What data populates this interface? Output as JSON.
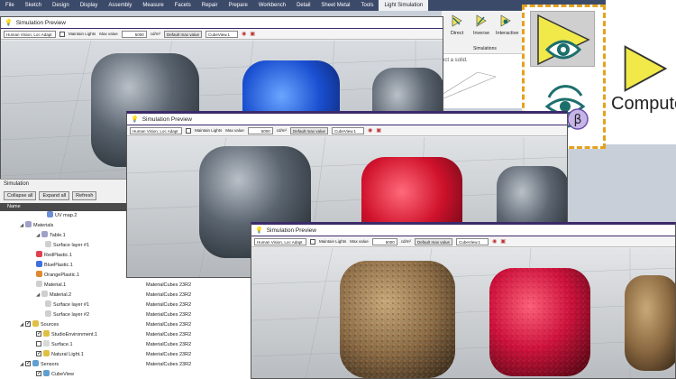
{
  "menu": [
    "File",
    "Sketch",
    "Design",
    "Display",
    "Assembly",
    "Measure",
    "Facets",
    "Repair",
    "Prepare",
    "Workbench",
    "Detail",
    "Sheet Metal",
    "Tools",
    "Light Simulation"
  ],
  "ribbon": {
    "buttons": [
      "Direct",
      "Inverse",
      "Interactive"
    ],
    "group": "Simulations",
    "hint": "ect a solid."
  },
  "zoom": {
    "compute_label": "Compute"
  },
  "toolbar": {
    "mode": "Human Vision, Loc Adapt",
    "maintain": "Maintain Lights",
    "max_label": "Max value",
    "max_value": "5000",
    "unit": "cd/m²",
    "default_btn": "Default max value",
    "view": "CubeView.1"
  },
  "windows": {
    "w1_title": "Simulation Preview",
    "w2_title": "Simulation Preview",
    "w3_title": "Simulation Preview"
  },
  "tree": {
    "header": "Simulation",
    "buttons": [
      "Collapse all",
      "Expand all",
      "Refresh"
    ],
    "col_name": "Name",
    "rows": [
      {
        "label": "UV map.2",
        "value": "",
        "indent": 52
      },
      {
        "label": "Materials",
        "value": "",
        "indent": 22
      },
      {
        "label": "Table.1",
        "value": "",
        "indent": 40
      },
      {
        "label": "Surface layer #1",
        "value": "",
        "indent": 50
      },
      {
        "label": "RedPlastic.1",
        "value": "",
        "indent": 40
      },
      {
        "label": "BluePlastic.1",
        "value": "",
        "indent": 40
      },
      {
        "label": "OrangePlastic.1",
        "value": "MaterialCubes 23R2",
        "indent": 40
      },
      {
        "label": "Material.1",
        "value": "MaterialCubes 23R2",
        "indent": 40
      },
      {
        "label": "Material.2",
        "value": "MaterialCubes 23R2",
        "indent": 40
      },
      {
        "label": "Surface layer #1",
        "value": "MaterialCubes 23R2",
        "indent": 50
      },
      {
        "label": "Surface layer #2",
        "value": "MaterialCubes 23R2",
        "indent": 50
      },
      {
        "label": "Sources",
        "value": "MaterialCubes 23R2",
        "indent": 22
      },
      {
        "label": "StudioEnvironment.1",
        "value": "MaterialCubes 23R2",
        "indent": 40
      },
      {
        "label": "Surface.1",
        "value": "MaterialCubes 23R2",
        "indent": 40
      },
      {
        "label": "Natural Light.1",
        "value": "MaterialCubes 23R2",
        "indent": 40
      },
      {
        "label": "Sensors",
        "value": "MaterialCubes 23R2",
        "indent": 22
      },
      {
        "label": "CubeView",
        "value": "",
        "indent": 40
      }
    ]
  }
}
